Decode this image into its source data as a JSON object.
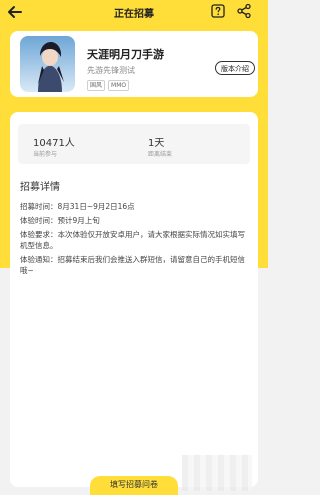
{
  "header": {
    "title": "正在招募",
    "back_icon": "back-arrow-icon",
    "help_icon": "help-icon",
    "share_icon": "share-icon"
  },
  "game": {
    "name": "天涯明月刀手游",
    "subtitle": "先游先锋测试",
    "tags": [
      "国风",
      "MMO"
    ],
    "version_button": "版本介绍"
  },
  "stats": [
    {
      "value": "10471人",
      "label": "当前参与"
    },
    {
      "value": "1天",
      "label": "距离结束"
    }
  ],
  "details": {
    "title": "招募详情",
    "items": [
      {
        "label": "招募时间：",
        "value": "8月31日~9月2日16点"
      },
      {
        "label": "体验时间：",
        "value": "预计9月上旬"
      },
      {
        "label": "体验要求：",
        "value": "本次体验仅开放安卓用户，请大家根据实际情况如实填写机型信息。"
      },
      {
        "label": "体验通知：",
        "value": "招募结束后我们会推送入群短信，请留意自己的手机短信哦~"
      }
    ]
  },
  "footer": {
    "button_label": "填写招募问卷"
  },
  "colors": {
    "accent": "#ffde3a",
    "background": "#f2f2f2",
    "card": "#ffffff"
  }
}
